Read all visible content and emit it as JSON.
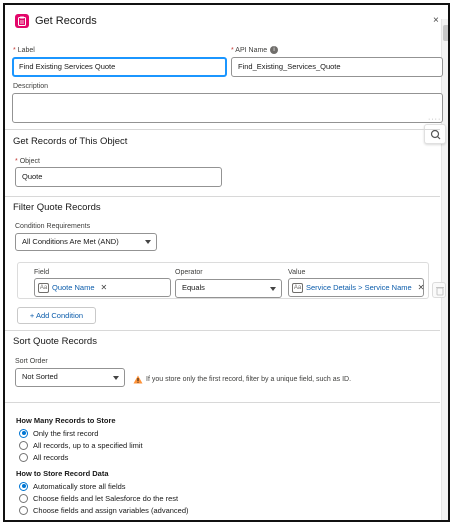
{
  "header": {
    "title": "Get Records",
    "icon": "get-records-icon",
    "close_label": "×"
  },
  "label_field": {
    "label": "Label",
    "value": "Find Existing Services Quote"
  },
  "api_field": {
    "label": "API Name",
    "value": "Find_Existing_Services_Quote"
  },
  "description": {
    "label": "Description",
    "value": ""
  },
  "object_section": {
    "title": "Get Records of This Object",
    "object_label": "Object",
    "object_value": "Quote"
  },
  "filter_section": {
    "title": "Filter Quote Records",
    "requirements_label": "Condition Requirements",
    "requirements_value": "All Conditions Are Met (AND)",
    "field_col": "Field",
    "operator_col": "Operator",
    "value_col": "Value",
    "condition": {
      "field": "Quote Name",
      "operator": "Equals",
      "value": "Service Details > Service Name"
    },
    "add_condition": "+ Add Condition"
  },
  "sort_section": {
    "title": "Sort Quote Records",
    "order_label": "Sort Order",
    "order_value": "Not Sorted",
    "warning": "If you store only the first record, filter by a unique field, such as ID."
  },
  "store_count": {
    "title": "How Many Records to Store",
    "options": [
      {
        "label": "Only the first record",
        "selected": true
      },
      {
        "label": "All records, up to a specified limit",
        "selected": false
      },
      {
        "label": "All records",
        "selected": false
      }
    ]
  },
  "store_data": {
    "title": "How to Store Record Data",
    "options": [
      {
        "label": "Automatically store all fields",
        "selected": true
      },
      {
        "label": "Choose fields and let Salesforce do the rest",
        "selected": false
      },
      {
        "label": "Choose fields and assign variables (advanced)",
        "selected": false
      }
    ]
  },
  "colors": {
    "accent": "#1b96ff",
    "brand_pink": "#e3066a",
    "link": "#0b5cab",
    "warning": "#fe9339"
  },
  "required_mark": "*",
  "info_glyph": "i"
}
